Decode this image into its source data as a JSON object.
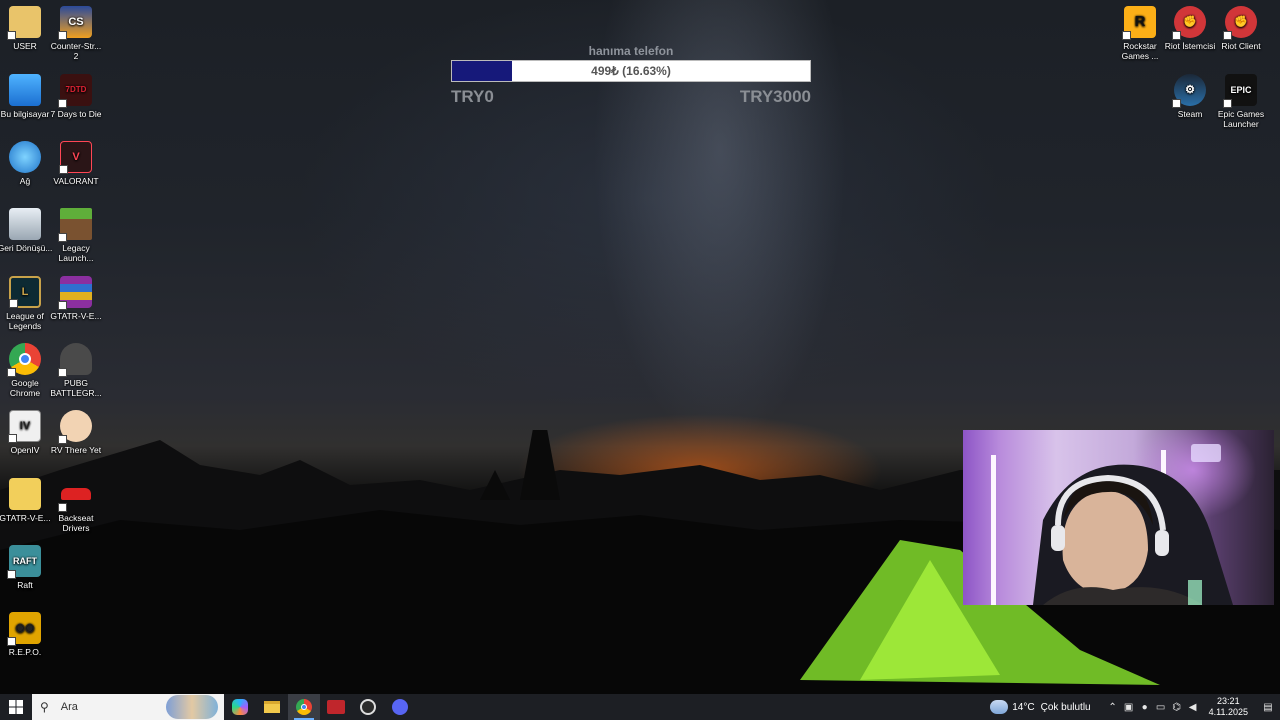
{
  "desktop": {
    "left_column_1": [
      {
        "label": "USER",
        "icon": "user-folder-icon"
      },
      {
        "label": "Bu bilgisayar",
        "icon": "this-pc-icon"
      },
      {
        "label": "Ağ",
        "icon": "network-icon"
      },
      {
        "label": "Geri Dönüşü...",
        "icon": "recycle-bin-icon"
      },
      {
        "label": "League of Legends",
        "icon": "league-of-legends-icon"
      },
      {
        "label": "Google Chrome",
        "icon": "chrome-icon"
      },
      {
        "label": "OpenIV",
        "icon": "openiv-icon"
      },
      {
        "label": "GTATR-V-E...",
        "icon": "folder-icon"
      },
      {
        "label": "Raft",
        "icon": "raft-icon"
      },
      {
        "label": "R.E.P.O.",
        "icon": "repo-icon"
      }
    ],
    "left_column_2": [
      {
        "label": "Counter-Str... 2",
        "icon": "counter-strike-icon"
      },
      {
        "label": "7 Days to Die",
        "icon": "7-days-to-die-icon"
      },
      {
        "label": "VALORANT",
        "icon": "valorant-icon"
      },
      {
        "label": "Legacy Launch...",
        "icon": "legacy-launcher-icon"
      },
      {
        "label": "GTATR-V-E...",
        "icon": "winrar-icon"
      },
      {
        "label": "PUBG BATTLEGR...",
        "icon": "pubg-icon"
      },
      {
        "label": "RV There Yet",
        "icon": "rv-there-yet-icon"
      },
      {
        "label": "Backseat Drivers",
        "icon": "backseat-drivers-icon"
      }
    ],
    "right_icons": [
      {
        "label": "Rockstar Games ...",
        "icon": "rockstar-icon"
      },
      {
        "label": "Riot İstemcisi",
        "icon": "riot-client-icon"
      },
      {
        "label": "Riot Client",
        "icon": "riot-client-icon"
      },
      {
        "label": "Steam",
        "icon": "steam-icon"
      },
      {
        "label": "Epic Games Launcher",
        "icon": "epic-games-icon"
      }
    ]
  },
  "donation": {
    "title": "hanıma telefon",
    "amount_text": "499₺ (16.63%)",
    "progress": 0.1663,
    "min_label": "TRY0",
    "max_label": "TRY3000"
  },
  "taskbar": {
    "search_placeholder": "Ara",
    "weather_temp": "14°C",
    "weather_text": "Çok bulutlu",
    "time": "23:21",
    "date": "4.11.2025"
  },
  "colors": {
    "donation_fill": "#16197a",
    "taskbar": "#1d1f24"
  }
}
